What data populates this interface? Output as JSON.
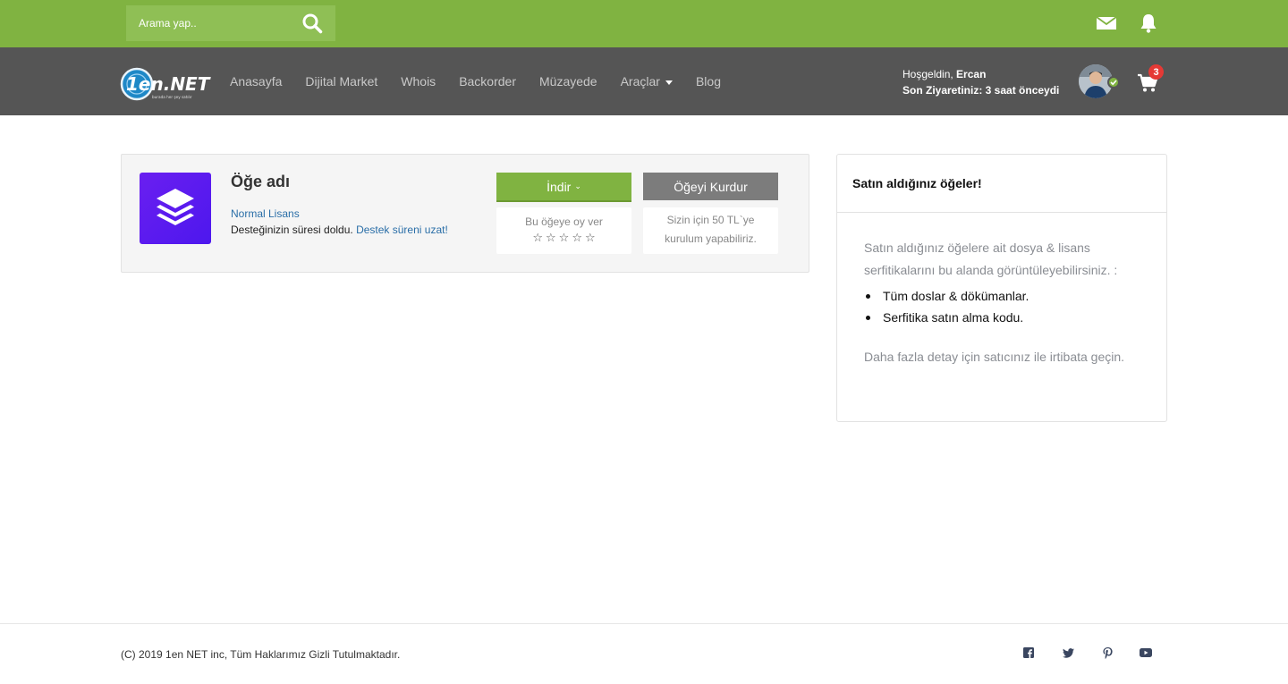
{
  "search": {
    "placeholder": "Arama yap.."
  },
  "brand": {
    "logo_text": "1en.NET",
    "logo_tagline": "burada her şey satılır"
  },
  "nav": {
    "items": [
      {
        "label": "Anasayfa"
      },
      {
        "label": "Dijital Market"
      },
      {
        "label": "Whois"
      },
      {
        "label": "Backorder"
      },
      {
        "label": "Müzayede"
      },
      {
        "label": "Araçlar",
        "has_dropdown": true
      },
      {
        "label": "Blog"
      }
    ]
  },
  "user": {
    "greeting": "Hoşgeldin, ",
    "name": "Ercan",
    "last_visit": "Son Ziyaretiniz: 3 saat önceydi",
    "status": "online"
  },
  "cart": {
    "count": "3"
  },
  "item": {
    "title": "Öğe adı",
    "license": "Normal Lisans",
    "support_text": "Desteğinizin süresi doldu. ",
    "support_link": "Destek süreni uzat!",
    "download_label": "İndir",
    "install_label": "Öğeyi Kurdur",
    "rate_label": "Bu öğeye oy ver",
    "rating": {
      "value": 0,
      "max": 5
    },
    "install_note_line1": "Sizin için 50 TL`ye",
    "install_note_line2": "kurulum yapabiliriz."
  },
  "sidebar": {
    "title": "Satın aldığınız öğeler!",
    "intro": "Satın aldığınız öğelere ait dosya & lisans serfitikalarını bu alanda görüntüleyebilirsiniz. :",
    "list": [
      "Tüm doslar & dökümanlar.",
      "Serfitika satın alma kodu."
    ],
    "outro": "Daha fazla detay için satıcınız ile irtibata geçin."
  },
  "footer": {
    "copyright": "(C) 2019 1en NET inc, Tüm Haklarımız Gizli Tutulmaktadır.",
    "social": [
      "facebook-icon",
      "twitter-icon",
      "pinterest-icon",
      "youtube-icon"
    ]
  },
  "colors": {
    "topbar": "#80b341",
    "navbar": "#555555",
    "accent_link": "#2a6ea7",
    "install_button": "#7c7c7c",
    "thumb": "#5a1ef0",
    "badge": "#e53935"
  }
}
